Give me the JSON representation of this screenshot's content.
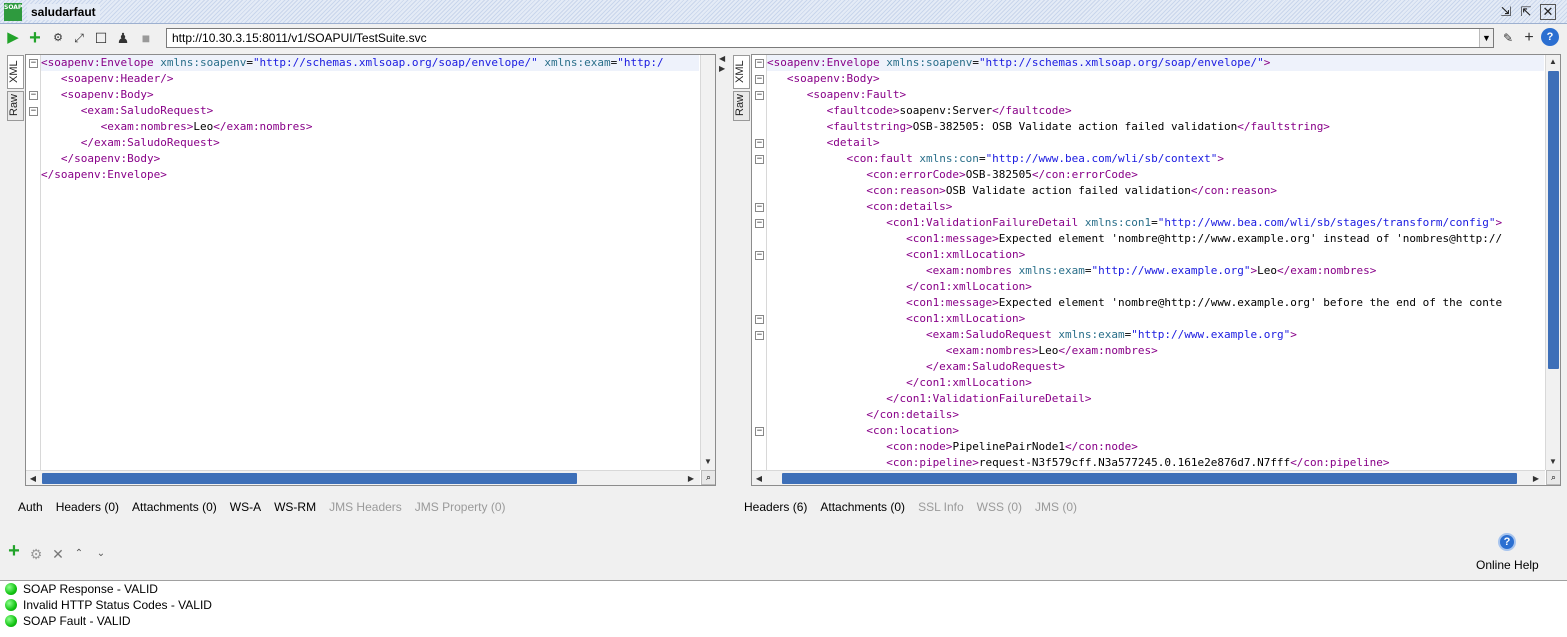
{
  "window": {
    "title": "saludarfaut",
    "app_icon_text": "SOAP"
  },
  "toolbar": {
    "url": "http://10.30.3.15:8011/v1/SOAPUI/TestSuite.svc"
  },
  "request_panel": {
    "side_tabs": [
      "XML",
      "Raw"
    ],
    "lines": [
      [
        [
          "tg",
          "<soapenv:Envelope "
        ],
        [
          "an",
          "xmlns:soapenv"
        ],
        [
          "tx",
          "="
        ],
        [
          "av",
          "\"http://schemas.xmlsoap.org/soap/envelope/\""
        ],
        [
          "tx",
          " "
        ],
        [
          "an",
          "xmlns:exam"
        ],
        [
          "tx",
          "="
        ],
        [
          "av",
          "\"http:/"
        ]
      ],
      [
        [
          "tg",
          "   <soapenv:Header/>"
        ]
      ],
      [
        [
          "tg",
          "   <soapenv:Body>"
        ]
      ],
      [
        [
          "tg",
          "      <exam:SaludoRequest>"
        ]
      ],
      [
        [
          "tg",
          "         <exam:nombres>"
        ],
        [
          "tx",
          "Leo"
        ],
        [
          "tg",
          "</exam:nombres>"
        ]
      ],
      [
        [
          "tg",
          "      </exam:SaludoRequest>"
        ]
      ],
      [
        [
          "tg",
          "   </soapenv:Body>"
        ]
      ],
      [
        [
          "tg",
          "</soapenv:Envelope>"
        ]
      ]
    ],
    "tabs": [
      {
        "label": "Auth",
        "disabled": false
      },
      {
        "label": "Headers (0)",
        "disabled": false
      },
      {
        "label": "Attachments (0)",
        "disabled": false
      },
      {
        "label": "WS-A",
        "disabled": false
      },
      {
        "label": "WS-RM",
        "disabled": false
      },
      {
        "label": "JMS Headers",
        "disabled": true
      },
      {
        "label": "JMS Property (0)",
        "disabled": true
      }
    ]
  },
  "response_panel": {
    "side_tabs": [
      "XML",
      "Raw"
    ],
    "lines": [
      [
        [
          "tg",
          "<soapenv:Envelope "
        ],
        [
          "an",
          "xmlns:soapenv"
        ],
        [
          "tx",
          "="
        ],
        [
          "av",
          "\"http://schemas.xmlsoap.org/soap/envelope/\""
        ],
        [
          "tg",
          ">"
        ]
      ],
      [
        [
          "tg",
          "   <soapenv:Body>"
        ]
      ],
      [
        [
          "tg",
          "      <soapenv:Fault>"
        ]
      ],
      [
        [
          "tg",
          "         <faultcode>"
        ],
        [
          "tx",
          "soapenv:Server"
        ],
        [
          "tg",
          "</faultcode>"
        ]
      ],
      [
        [
          "tg",
          "         <faultstring>"
        ],
        [
          "tx",
          "OSB-382505: OSB Validate action failed validation"
        ],
        [
          "tg",
          "</faultstring>"
        ]
      ],
      [
        [
          "tg",
          "         <detail>"
        ]
      ],
      [
        [
          "tg",
          "            <con:fault "
        ],
        [
          "an",
          "xmlns:con"
        ],
        [
          "tx",
          "="
        ],
        [
          "av",
          "\"http://www.bea.com/wli/sb/context\""
        ],
        [
          "tg",
          ">"
        ]
      ],
      [
        [
          "tg",
          "               <con:errorCode>"
        ],
        [
          "tx",
          "OSB-382505"
        ],
        [
          "tg",
          "</con:errorCode>"
        ]
      ],
      [
        [
          "tg",
          "               <con:reason>"
        ],
        [
          "tx",
          "OSB Validate action failed validation"
        ],
        [
          "tg",
          "</con:reason>"
        ]
      ],
      [
        [
          "tg",
          "               <con:details>"
        ]
      ],
      [
        [
          "tg",
          "                  <con1:ValidationFailureDetail "
        ],
        [
          "an",
          "xmlns:con1"
        ],
        [
          "tx",
          "="
        ],
        [
          "av",
          "\"http://www.bea.com/wli/sb/stages/transform/config\""
        ],
        [
          "tg",
          ">"
        ]
      ],
      [
        [
          "tg",
          "                     <con1:message>"
        ],
        [
          "tx",
          "Expected element 'nombre@http://www.example.org' instead of 'nombres@http://"
        ]
      ],
      [
        [
          "tg",
          "                     <con1:xmlLocation>"
        ]
      ],
      [
        [
          "tg",
          "                        <exam:nombres "
        ],
        [
          "an",
          "xmlns:exam"
        ],
        [
          "tx",
          "="
        ],
        [
          "av",
          "\"http://www.example.org\""
        ],
        [
          "tg",
          ">"
        ],
        [
          "tx",
          "Leo"
        ],
        [
          "tg",
          "</exam:nombres>"
        ]
      ],
      [
        [
          "tg",
          "                     </con1:xmlLocation>"
        ]
      ],
      [
        [
          "tg",
          "                     <con1:message>"
        ],
        [
          "tx",
          "Expected element 'nombre@http://www.example.org' before the end of the conte"
        ]
      ],
      [
        [
          "tg",
          "                     <con1:xmlLocation>"
        ]
      ],
      [
        [
          "tg",
          "                        <exam:SaludoRequest "
        ],
        [
          "an",
          "xmlns:exam"
        ],
        [
          "tx",
          "="
        ],
        [
          "av",
          "\"http://www.example.org\""
        ],
        [
          "tg",
          ">"
        ]
      ],
      [
        [
          "tg",
          "                           <exam:nombres>"
        ],
        [
          "tx",
          "Leo"
        ],
        [
          "tg",
          "</exam:nombres>"
        ]
      ],
      [
        [
          "tg",
          "                        </exam:SaludoRequest>"
        ]
      ],
      [
        [
          "tg",
          "                     </con1:xmlLocation>"
        ]
      ],
      [
        [
          "tg",
          "                  </con1:ValidationFailureDetail>"
        ]
      ],
      [
        [
          "tg",
          "               </con:details>"
        ]
      ],
      [
        [
          "tg",
          "               <con:location>"
        ]
      ],
      [
        [
          "tg",
          "                  <con:node>"
        ],
        [
          "tx",
          "PipelinePairNode1"
        ],
        [
          "tg",
          "</con:node>"
        ]
      ],
      [
        [
          "tg",
          "                  <con:pipeline>"
        ],
        [
          "tx",
          "request-N3f579cff.N3a577245.0.161e2e876d7.N7fff"
        ],
        [
          "tg",
          "</con:pipeline>"
        ]
      ]
    ],
    "tabs": [
      {
        "label": "Headers (6)",
        "disabled": false
      },
      {
        "label": "Attachments (0)",
        "disabled": false
      },
      {
        "label": "SSL Info",
        "disabled": true
      },
      {
        "label": "WSS (0)",
        "disabled": true
      },
      {
        "label": "JMS (0)",
        "disabled": true
      }
    ]
  },
  "assertions": {
    "help_label": "Online Help",
    "items": [
      {
        "label": "SOAP Response - VALID",
        "status_color": "#12c412"
      },
      {
        "label": "Invalid HTTP Status Codes - VALID",
        "status_color": "#12c412"
      },
      {
        "label": "SOAP Fault - VALID",
        "status_color": "#12c412"
      }
    ]
  }
}
